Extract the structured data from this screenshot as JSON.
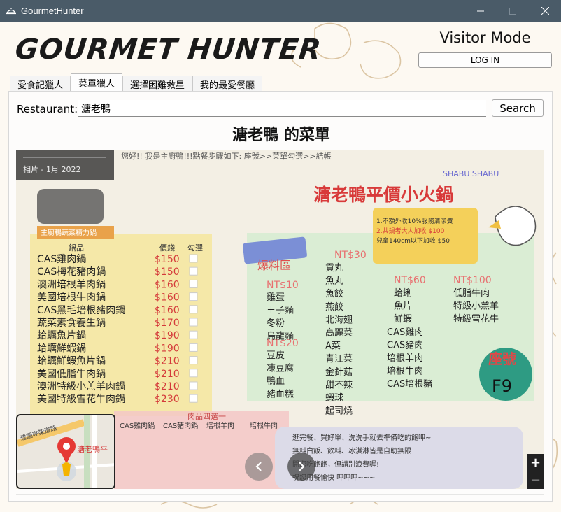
{
  "window": {
    "title": "GourmetHunter"
  },
  "header": {
    "logo": "GOURMET HUNTER",
    "mode": "Visitor Mode",
    "login_label": "LOG IN"
  },
  "tabs": [
    {
      "label": "愛食記獵人",
      "active": false
    },
    {
      "label": "菜單獵人",
      "active": true
    },
    {
      "label": "選擇困難救星",
      "active": false
    },
    {
      "label": "我的最愛餐廳",
      "active": false
    }
  ],
  "search": {
    "label": "Restaurant:",
    "value": "溏老鴨",
    "button_label": "Search"
  },
  "menu": {
    "title": "溏老鴨 的菜單",
    "photo_caption": "相片 - 1月 2022",
    "sign_title": "溏老鴨平價小火鍋",
    "sign_sub": "SHABU SHABU",
    "intro": "您好!! 我是主廚鴨!!!點餐步驟如下: 座號>>菜單勾選>>結帳",
    "section_title": "主廚鴨蔬菜精力鍋",
    "col_headers": [
      "鍋品",
      "價錢",
      "勾選"
    ],
    "items": [
      {
        "name": "CAS雞肉鍋",
        "price": "$150"
      },
      {
        "name": "CAS梅花豬肉鍋",
        "price": "$150"
      },
      {
        "name": "澳洲培根羊肉鍋",
        "price": "$160"
      },
      {
        "name": "美國培根牛肉鍋",
        "price": "$160"
      },
      {
        "name": "CAS黑毛培根豬肉鍋",
        "price": "$160"
      },
      {
        "name": "蔬菜素食養生鍋",
        "price": "$170"
      },
      {
        "name": "蛤蠣魚片鍋",
        "price": "$190"
      },
      {
        "name": "蛤蠣鮮蝦鍋",
        "price": "$190"
      },
      {
        "name": "蛤蠣鮮蝦魚片鍋",
        "price": "$210"
      },
      {
        "name": "美國低脂牛肉鍋",
        "price": "$210"
      },
      {
        "name": "澳洲特級小羔羊肉鍋",
        "price": "$210"
      },
      {
        "name": "美國特級雪花牛肉鍋",
        "price": "$230"
      }
    ],
    "nt10_label": "NT$10",
    "nt10_items": [
      "雞蛋",
      "王子麵",
      "冬粉",
      "烏龍麵"
    ],
    "nt20_label": "NT$20",
    "nt20_items": [
      "豆皮",
      "凍豆腐",
      "鴨血",
      "豬血糕"
    ],
    "nt30_label": "NT$30",
    "nt30_items": [
      "貢丸",
      "魚丸",
      "魚餃",
      "燕餃",
      "北海翅",
      "高麗菜",
      "A菜",
      "青江菜",
      "金針菇",
      "甜不辣",
      "蝦球",
      "起司燒"
    ],
    "nt60_label": "NT$60",
    "nt60_items": [
      "蛤蜊",
      "魚片",
      "鮮蝦"
    ],
    "nt100_label": "NT$100",
    "nt100_items": [
      "低脂牛肉",
      "特級小羔羊",
      "特級雪花牛"
    ],
    "cas_items": [
      "CAS雞肉",
      "CAS豬肉",
      "培根羊肉",
      "培根牛肉",
      "CAS培根豬"
    ],
    "bubble": "爆料區",
    "seat": "座號",
    "seat_no": "F9",
    "notes": [
      "1.不額外收10%服務清潔費",
      "2.共鍋者大人加收 $100",
      "兒童140cm以下加收 $50"
    ],
    "footer_notes": [
      "逛完餐、買好單、洗洗手就去準備吃的飽呷~",
      "無料白飯、飲料、冰淇淋皆是自助無限",
      "開您吃飽飽，但請別浪費喔!",
      "祝您用餐愉快 呷呷呷~~~"
    ],
    "meat_label": "肉品四選一",
    "meat_items": [
      "CAS雞肉鍋",
      "CAS豬肉鍋",
      "培根羊肉",
      "培根牛肉"
    ]
  },
  "map": {
    "place_label": "溏老鴨平",
    "road_label": "建國高架道路"
  }
}
